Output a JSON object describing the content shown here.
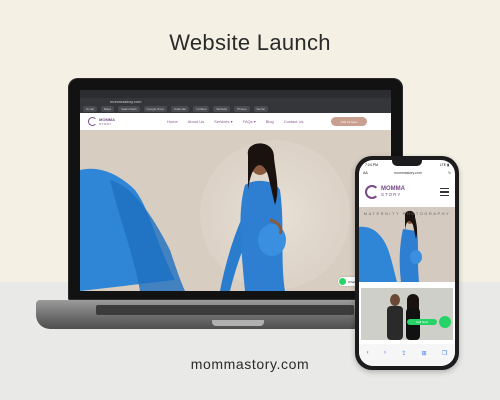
{
  "headline": "Website Launch",
  "footer_url": "mommastory.com",
  "laptop": {
    "browser": {
      "address": "mommastory.com",
      "bookmarks": [
        "Gmail",
        "Maps",
        "Sales Dash",
        "Google Drive",
        "Calendar",
        "Untitled",
        "Website",
        "Photos",
        "Social"
      ]
    },
    "site": {
      "logo_line1": "MOMMA",
      "logo_line2": "STORY",
      "nav": [
        "Home",
        "About Us",
        "Services ▾",
        "FAQs ▾",
        "Blog",
        "Contact Us"
      ],
      "cta": "Call Us Now",
      "whatsapp": "WhatsApp"
    }
  },
  "phone": {
    "time": "7:24 PM",
    "signal": "LTE ▮",
    "aa": "AA",
    "address": "mommastory.com",
    "logo_line1": "MOMMA",
    "logo_line2": "STORY",
    "banner": "MATERNITY PHOTOGRAPHY",
    "call_label": "Call Now",
    "bottom_icons": [
      "‹",
      "›",
      "⇪",
      "⊞",
      "❐"
    ]
  },
  "colors": {
    "background": "#f4f1e4",
    "brand_purple": "#7a4a86",
    "dress_blue": "#2e7fd1",
    "whatsapp_green": "#25d366"
  }
}
